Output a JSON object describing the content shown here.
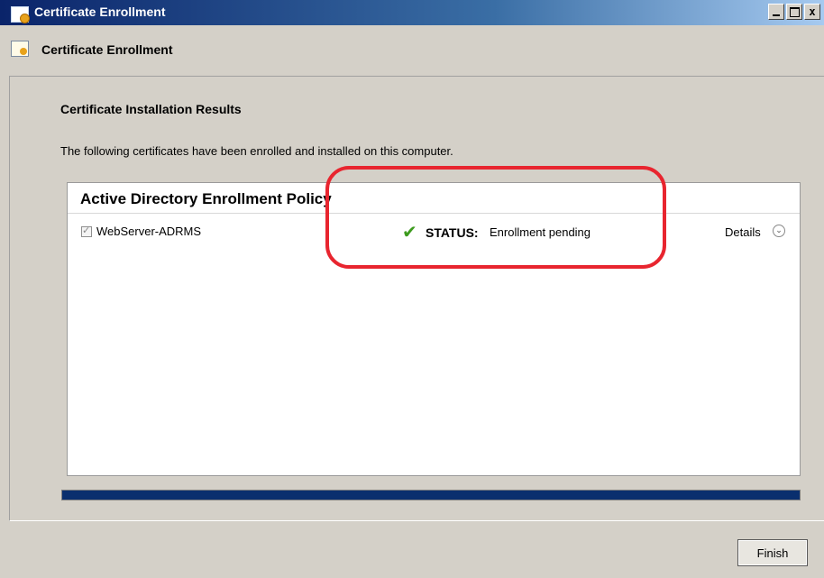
{
  "window": {
    "title": "Certificate Enrollment",
    "app_icon": "certificate-icon",
    "controls": [
      "minimize",
      "maximize",
      "close"
    ],
    "close_glyph": "x"
  },
  "header": {
    "title": "Certificate Enrollment",
    "icon": "certificate-icon"
  },
  "main": {
    "heading": "Certificate Installation Results",
    "intro": "The following certificates have been enrolled and installed on this computer.",
    "policy": {
      "title": "Active Directory Enrollment Policy",
      "certificates": [
        {
          "checked": true,
          "name": "WebServer-ADRMS",
          "status_label": "STATUS:",
          "status_value": "Enrollment pending",
          "status_icon": "checkmark-icon",
          "details_label": "Details",
          "details_icon": "chevron-down-circle-icon"
        }
      ]
    },
    "progress": 1.0,
    "annotation_color": "#e8252f"
  },
  "footer": {
    "finish_label": "Finish"
  }
}
